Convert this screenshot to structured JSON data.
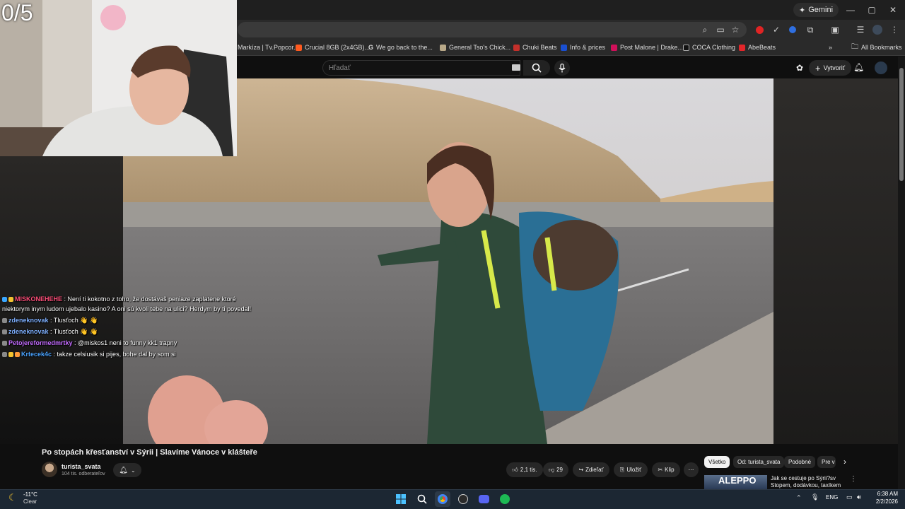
{
  "webcam": {
    "counter": "0/5"
  },
  "browser": {
    "gemini_label": "Gemini",
    "window_controls": [
      "—",
      "▢",
      "✕"
    ],
    "bookmarks": [
      {
        "label": "Markíza | Tv.Popcor...",
        "color": "#2a2a2a"
      },
      {
        "label": "Crucial 8GB (2x4GB)...",
        "color": "#ff5a1f"
      },
      {
        "label": "We go back to the...",
        "color": "#2a2a2a"
      },
      {
        "label": "General Tso's Chick...",
        "color": "#b8a888"
      },
      {
        "label": "Chuki Beats",
        "color": "#c4302b"
      },
      {
        "label": "Info & prices",
        "color": "#1a4fd0"
      },
      {
        "label": "Post Malone | Drake...",
        "color": "#d0105a"
      },
      {
        "label": "COCA Clothing",
        "color": "#111111"
      },
      {
        "label": "AbeBeats",
        "color": "#e3262a"
      }
    ],
    "all_bookmarks_label": "All Bookmarks"
  },
  "youtube": {
    "search_placeholder": "Hľadať",
    "create_label": "Vytvoriť",
    "video_title": "Po stopách křesťanství v Sýrii | Slavíme Vánoce v klášteře",
    "channel_name": "turista_svata",
    "channel_subs": "104 tis. odberateľov",
    "like_count": "2,1 tis.",
    "dislike_count": "29",
    "share_label": "Zdieľať",
    "save_label": "Uložiť",
    "clip_label": "Klip",
    "more_label": "⋯",
    "chips": [
      "Všetko",
      "Od: turista_svata",
      "Podobné",
      "Pre v"
    ],
    "rec_thumb_text": "ALEPPO",
    "rec_title": "Jak se cestuje po Sýrii?sv Stopem, dodávkou, taxíkem a..."
  },
  "chat": [
    {
      "user": "MISKONEHEHE",
      "color": "#ff4f7a",
      "text": " : Není ti kokotno z toho, že dostávaš peniaze zaplatene ktoré",
      "cont": "niektorym inym ludom ujebalo kasino? A oni sú kvoli tebe na ulici? Herdym by ti povedal!"
    },
    {
      "user": "zdeneknovak",
      "color": "#7fb0ff",
      "text": " : Tlusťoch  👋 👋"
    },
    {
      "user": "zdeneknovak",
      "color": "#7fb0ff",
      "text": " : Tlusťoch  👋 👋"
    },
    {
      "user": "Petojereformedmrtky",
      "color": "#c36bff",
      "text": " : @miskos1 neni to funny kk1 trapny"
    },
    {
      "user": "Krtecek4c",
      "color": "#4aa3ff",
      "text": " : takze celsiusik si pijes, bohe dal by som si"
    }
  ],
  "taskbar": {
    "temp": "-11°C",
    "condition": "Clear",
    "lang": "ENG",
    "time": "6:38 AM",
    "date": "2/2/2026"
  },
  "colors": {
    "accent": "#3ea6ff",
    "bg": "#0f0f0f"
  }
}
